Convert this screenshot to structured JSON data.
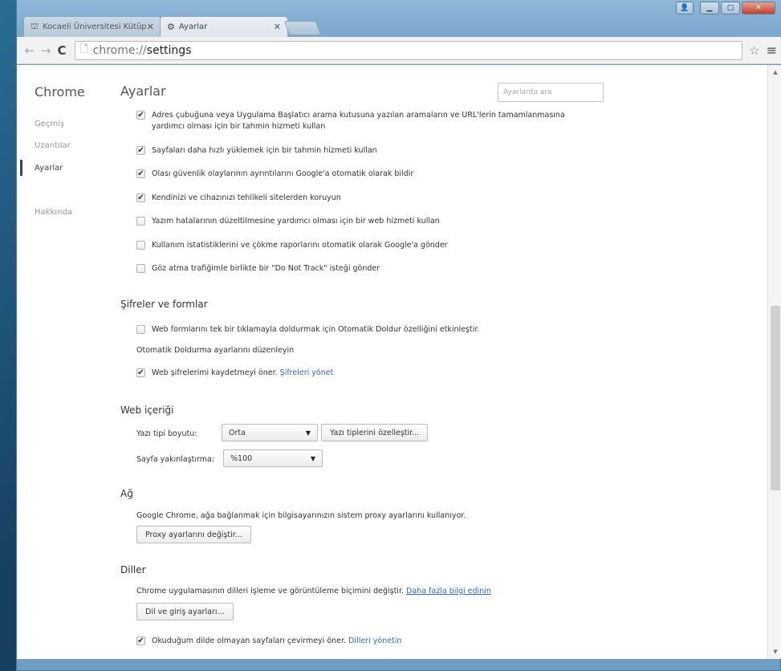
{
  "tabs": [
    {
      "label": "Kocaeli Üniversitesi Kütüp",
      "icon": "library-favicon-icon",
      "active": false
    },
    {
      "label": "Ayarlar",
      "icon": "gear-icon",
      "active": true
    }
  ],
  "toolbar": {
    "url_scheme": "chrome://",
    "url_path": "settings"
  },
  "sidebar": {
    "brand": "Chrome",
    "items": [
      {
        "label": "Geçmiş"
      },
      {
        "label": "Uzantılar"
      },
      {
        "label": "Ayarlar"
      },
      {
        "label": "Hakkında"
      }
    ]
  },
  "main": {
    "title": "Ayarlar",
    "search_placeholder": "Ayarlarda ara",
    "privacy": [
      {
        "label_line1": "Adres çubuğuna veya Uygulama Başlatıcı arama kutusuna yazılan aramaların ve URL'lerin tamamlanmasına",
        "label_line2": "yardımcı olması için bir tahmin hizmeti kullan",
        "checked": true
      },
      {
        "label": "Sayfaları daha hızlı yüklemek için bir tahmin hizmeti kullan",
        "checked": true
      },
      {
        "label": "Olası güvenlik olaylarının ayrıntılarını Google'a otomatik olarak bildir",
        "checked": true
      },
      {
        "label": "Kendinizi ve cihazınızı tehlikeli sitelerden koruyun",
        "checked": true
      },
      {
        "label": "Yazım hatalarının düzeltilmesine yardımcı olması için bir web hizmeti kullan",
        "checked": false
      },
      {
        "label": "Kullanım istatistiklerini ve çökme raporlarını otomatik olarak Google'a gönder",
        "checked": false
      },
      {
        "label": "Göz atma trafiğimle birlikte bir \"Do Not Track\" isteği gönder",
        "checked": false
      }
    ],
    "passwords": {
      "title": "Şifreler ve formlar",
      "autofill_label": "Web formlarını tek bir tıklamayla doldurmak için Otomatik Doldur özelliğini etkinleştir.",
      "autofill_checked": false,
      "autofill_link": "Otomatik Doldurma ayarlarını düzenleyin",
      "save_pw_label": "Web şifrelerimi kaydetmeyi öner.",
      "save_pw_link": "Şifreleri yönet",
      "save_pw_checked": true
    },
    "web_content": {
      "title": "Web içeriği",
      "font_size_label": "Yazı tipi boyutu:",
      "font_size_value": "Orta",
      "customize_fonts_button": "Yazı tiplerini özelleştir...",
      "zoom_label": "Sayfa yakınlaştırma:",
      "zoom_value": "%100"
    },
    "network": {
      "title": "Ağ",
      "description": "Google Chrome, ağa bağlanmak için bilgisayarınızın sistem proxy ayarlarını kullanıyor.",
      "proxy_button": "Proxy ayarlarını değiştir..."
    },
    "languages": {
      "title": "Diller",
      "description": "Chrome uygulamasının dilleri işleme ve görüntüleme biçimini değiştir.",
      "learn_more_link": "Daha fazla bilgi edinin",
      "lang_button": "Dil ve giriş ayarları...",
      "translate_label": "Okuduğum dilde olmayan sayfaları çevirmeyi öner.",
      "translate_link": "Dilleri yönetin",
      "translate_checked": true
    }
  }
}
